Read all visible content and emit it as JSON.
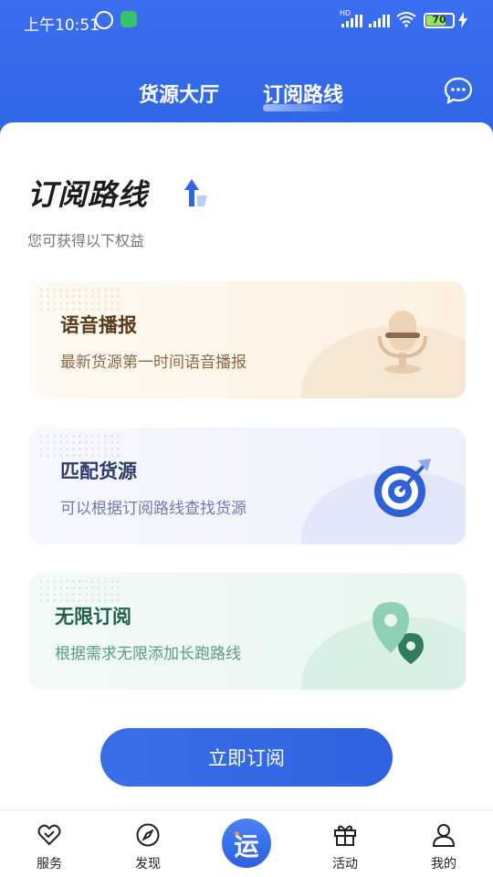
{
  "status_bar": {
    "time": "上午10:51",
    "network_label": "HD",
    "battery_level": "70",
    "battery_fraction": 0.7,
    "icons": [
      "alarm-icon",
      "app-notification-icon",
      "signal-icon",
      "signal-icon",
      "wifi-icon",
      "battery-icon",
      "charging-icon"
    ]
  },
  "header": {
    "tabs": [
      {
        "label": "货源大厅",
        "active": false
      },
      {
        "label": "订阅路线",
        "active": true
      }
    ],
    "message_icon": "chat-bubble-icon"
  },
  "hero": {
    "title": "订阅路线",
    "title_icon": "up-arrow-icon",
    "subtitle": "您可获得以下权益"
  },
  "benefits": [
    {
      "title": "语音播报",
      "description": "最新货源第一时间语音播报",
      "icon": "microphone-icon",
      "accent": "#e8c9a8"
    },
    {
      "title": "匹配货源",
      "description": "可以根据订阅路线查找货源",
      "icon": "target-icon",
      "accent": "#3165e0"
    },
    {
      "title": "无限订阅",
      "description": "根据需求无限添加长跑路线",
      "icon": "location-pin-icon",
      "accent": "#4aa382"
    }
  ],
  "cta": {
    "label": "立即订阅"
  },
  "bottom_nav": {
    "items": [
      {
        "label": "服务",
        "icon": "heart-icon"
      },
      {
        "label": "发现",
        "icon": "compass-icon"
      },
      {
        "label": "活动",
        "icon": "gift-icon"
      },
      {
        "label": "我的",
        "icon": "person-icon"
      }
    ],
    "center": {
      "label": "运",
      "icon": "center-logo-icon"
    }
  },
  "colors": {
    "brand_blue": "#2f66e6",
    "text_dark": "#1c1c1c"
  }
}
